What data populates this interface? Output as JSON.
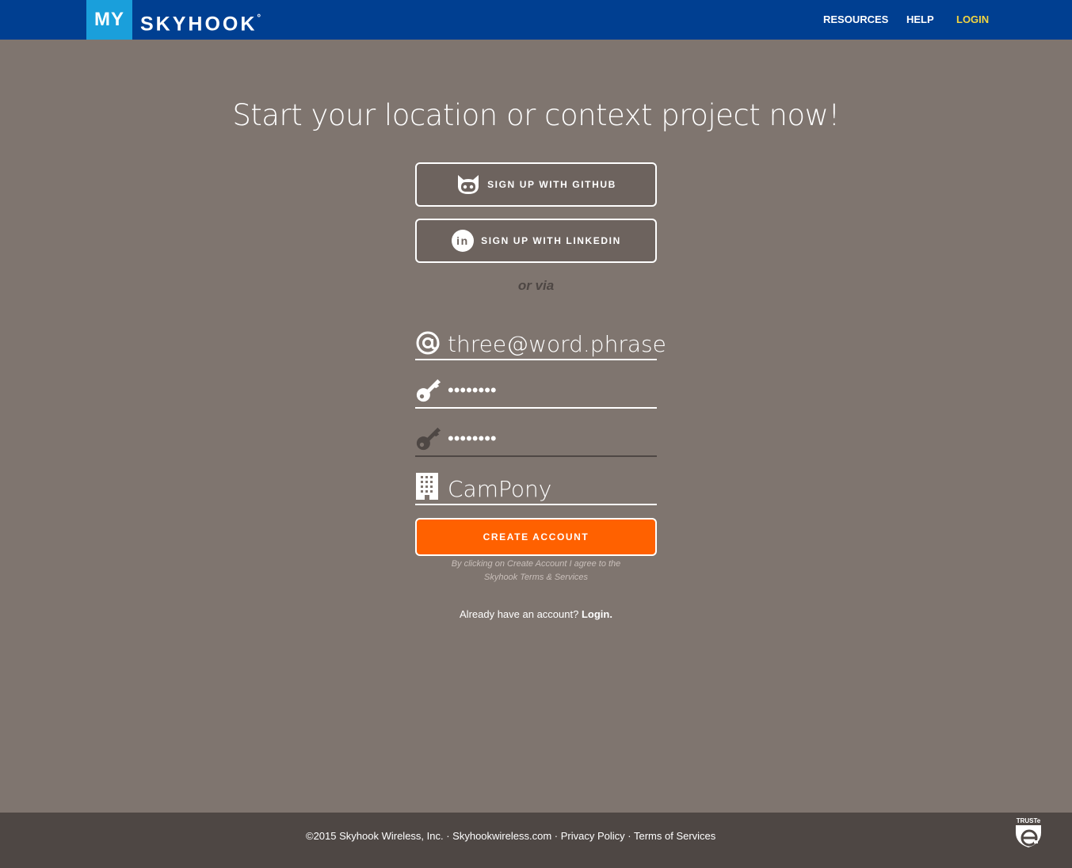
{
  "header": {
    "logo_my": "MY",
    "logo_sky": "SKYHOOK",
    "logo_mark": "°",
    "nav": {
      "resources": "RESOURCES",
      "help": "HELP",
      "login": "LOGIN"
    },
    "login_color": "#f2d541",
    "bar_color": "#003f91"
  },
  "main": {
    "headline": "Start your location or context project now!",
    "github_label": "SIGN UP WITH GITHUB",
    "linkedin_label": "SIGN UP WITH LINKEDIN",
    "linkedin_icon_text": "in",
    "or_via": "or via",
    "email_value": "three@word.phrase",
    "password_value": "••••••••",
    "password_confirm_value": "••••••••",
    "company_value": "CamPony",
    "create_label": "CREATE ACCOUNT",
    "create_color": "#ff6100",
    "terms_line1": "By clicking on Create Account I agree to the",
    "terms_line2": "Skyhook Terms & Services",
    "already_text": "Already have an account?",
    "already_link": "Login."
  },
  "icons": {
    "email": "at-icon",
    "password": "key-icon",
    "company": "building-icon",
    "github": "github-octocat-icon",
    "linkedin": "linkedin-icon"
  },
  "footer": {
    "copyright": "©2015 Skyhook Wireless, Inc.",
    "sep": " · ",
    "site": "Skyhookwireless.com",
    "privacy": "Privacy Policy",
    "terms": "Terms of Services",
    "truste": "TRUSTe"
  }
}
